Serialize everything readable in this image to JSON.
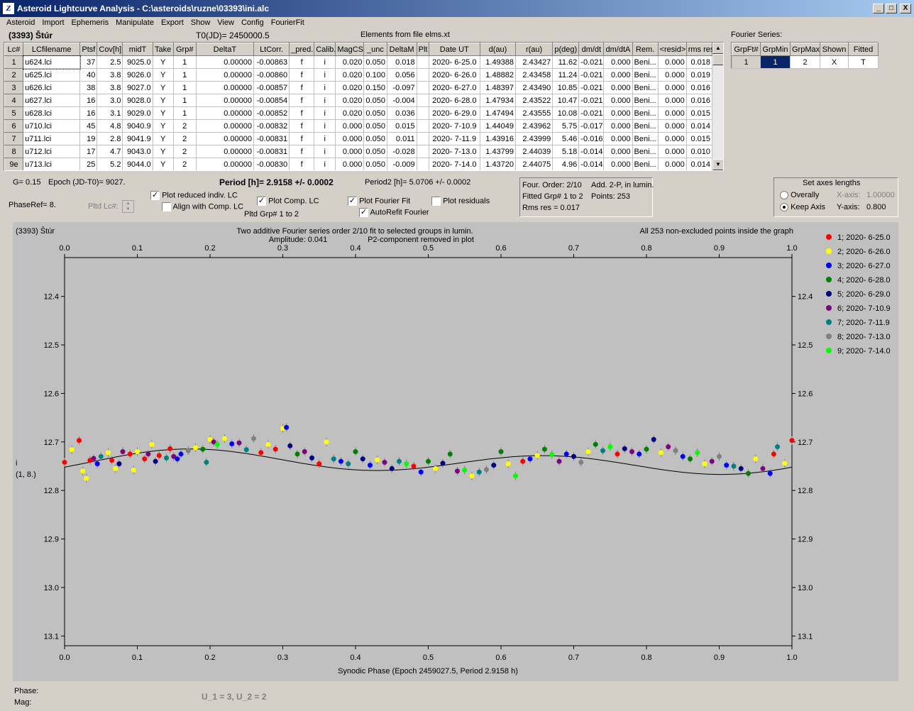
{
  "window": {
    "title": "Asteroid Lightcurve Analysis - C:\\asteroids\\ruzne\\03393\\ini.alc",
    "icon": "app-icon",
    "minimize": "_",
    "maximize": "□",
    "close": "X"
  },
  "menu": [
    "Asteroid",
    "Import",
    "Ephemeris",
    "Manipulate",
    "Export",
    "Show",
    "View",
    "Config",
    "FourierFit"
  ],
  "header": {
    "asteroid": "(3393) Štúr",
    "t0": "T0(JD)= 2450000.5",
    "elements": "Elements from file elms.xt",
    "fourier_series_label": "Fourier Series:"
  },
  "table": {
    "columns": [
      "Lc#",
      "LCfilename",
      "Ptsf",
      "Cov[h]",
      "midT",
      "Take",
      "Grp#",
      "DeltaT",
      "LtCorr.",
      "_pred.",
      "Calib.",
      "MagCS",
      "_unc",
      "DeltaM",
      "Plt",
      "Date UT",
      "d(au)",
      "r(au)",
      "p(deg)",
      "dm/dt",
      "dm/dtA",
      "Rem.",
      "<resid>",
      "rms res"
    ],
    "rows": [
      [
        "1",
        "u624.lci",
        "37",
        "2.5",
        "9025.0",
        "Y",
        "1",
        "0.00000",
        "-0.00863",
        "f",
        "i",
        "0.020",
        "0.050",
        "0.018",
        "",
        "2020- 6-25.0",
        "1.49388",
        "2.43427",
        "11.62",
        "-0.021",
        "0.000",
        "Beni...",
        "0.000",
        "0.018"
      ],
      [
        "2",
        "u625.lci",
        "40",
        "3.8",
        "9026.0",
        "Y",
        "1",
        "0.00000",
        "-0.00860",
        "f",
        "i",
        "0.020",
        "0.100",
        "0.056",
        "",
        "2020- 6-26.0",
        "1.48882",
        "2.43458",
        "11.24",
        "-0.021",
        "0.000",
        "Beni...",
        "0.000",
        "0.019"
      ],
      [
        "3",
        "u626.lci",
        "38",
        "3.8",
        "9027.0",
        "Y",
        "1",
        "0.00000",
        "-0.00857",
        "f",
        "i",
        "0.020",
        "0.150",
        "-0.097",
        "",
        "2020- 6-27.0",
        "1.48397",
        "2.43490",
        "10.85",
        "-0.021",
        "0.000",
        "Beni...",
        "0.000",
        "0.016"
      ],
      [
        "4",
        "u627.lci",
        "16",
        "3.0",
        "9028.0",
        "Y",
        "1",
        "0.00000",
        "-0.00854",
        "f",
        "i",
        "0.020",
        "0.050",
        "-0.004",
        "",
        "2020- 6-28.0",
        "1.47934",
        "2.43522",
        "10.47",
        "-0.021",
        "0.000",
        "Beni...",
        "0.000",
        "0.016"
      ],
      [
        "5",
        "u628.lci",
        "16",
        "3.1",
        "9029.0",
        "Y",
        "1",
        "0.00000",
        "-0.00852",
        "f",
        "i",
        "0.020",
        "0.050",
        "0.036",
        "",
        "2020- 6-29.0",
        "1.47494",
        "2.43555",
        "10.08",
        "-0.021",
        "0.000",
        "Beni...",
        "0.000",
        "0.015"
      ],
      [
        "6",
        "u710.lci",
        "45",
        "4.8",
        "9040.9",
        "Y",
        "2",
        "0.00000",
        "-0.00832",
        "f",
        "i",
        "0.000",
        "0.050",
        "0.015",
        "",
        "2020- 7-10.9",
        "1.44049",
        "2.43962",
        "5.75",
        "-0.017",
        "0.000",
        "Beni...",
        "0.000",
        "0.014"
      ],
      [
        "7",
        "u711.lci",
        "19",
        "2.8",
        "9041.9",
        "Y",
        "2",
        "0.00000",
        "-0.00831",
        "f",
        "i",
        "0.000",
        "0.050",
        "0.011",
        "",
        "2020- 7-11.9",
        "1.43916",
        "2.43999",
        "5.46",
        "-0.016",
        "0.000",
        "Beni...",
        "0.000",
        "0.015"
      ],
      [
        "8",
        "u712.lci",
        "17",
        "4.7",
        "9043.0",
        "Y",
        "2",
        "0.00000",
        "-0.00831",
        "f",
        "i",
        "0.000",
        "0.050",
        "-0.028",
        "",
        "2020- 7-13.0",
        "1.43799",
        "2.44039",
        "5.18",
        "-0.014",
        "0.000",
        "Beni...",
        "0.000",
        "0.010"
      ],
      [
        "9e",
        "u713.lci",
        "25",
        "5.2",
        "9044.0",
        "Y",
        "2",
        "0.00000",
        "-0.00830",
        "f",
        "i",
        "0.000",
        "0.050",
        "-0.009",
        "",
        "2020- 7-14.0",
        "1.43720",
        "2.44075",
        "4.96",
        "-0.014",
        "0.000",
        "Beni...",
        "0.000",
        "0.014"
      ]
    ]
  },
  "fourier_table": {
    "columns": [
      "GrpFt#",
      "GrpMin",
      "GrpMax",
      "Shown",
      "Fitted"
    ],
    "row": [
      "1",
      "1",
      "2",
      "X",
      "T"
    ]
  },
  "controls": {
    "g": "G= 0.15",
    "epoch": "Epoch (JD-T0)= 9027.",
    "period": "Period [h]= 2.9158 +/- 0.0002",
    "period2": "Period2 [h]= 5.0706 +/- 0.0002",
    "phaseref": "PhaseRef= 8.",
    "pltd_lc": "Pltd Lc#:",
    "plot_reduced": "Plot reduced indiv. LC",
    "align_comp": "Align with Comp. LC",
    "plot_comp": "Plot Comp. LC",
    "pltd_grp": "Pltd Grp#  1   to   2",
    "plot_fourier": "Plot Fourier Fit",
    "autorefit": "AutoRefit Fourier",
    "plot_residuals": "Plot residuals",
    "info_order": "Four. Order:  2/10",
    "info_add": "Add. 2-P, in lumin.",
    "info_fitted": "Fitted Grp# 1 to 2",
    "info_points": "Points: 253",
    "info_rms": "Rms res      = 0.017",
    "axes_title": "Set axes lengths",
    "overally": "Overally",
    "keep_axis": "Keep Axis",
    "x_axis_label": "X-axis:",
    "x_axis_value": "1.00000",
    "y_axis_label": "Y-axis:",
    "y_axis_value": "0.800",
    "phase": "Phase:",
    "mag": "Mag:",
    "u_values": "U_1 = 3, U_2 = 2"
  },
  "chart_data": {
    "type": "scatter",
    "title_left": "(3393) Štúr",
    "title_center_1": "Two additive Fourier series order 2/10 fit to selected groups in lumin.",
    "title_center_2": "Amplitude: 0.041",
    "title_center_3": "P2-component removed in plot",
    "title_right": "All 253 non-excluded points inside the graph",
    "xlabel": "Synodic Phase (Epoch 2459027.5, Period 2.9158 h)",
    "ylabel_1": "i",
    "ylabel_2": "(1, 8.)",
    "xlim": [
      0,
      1
    ],
    "ylim": [
      12.32,
      13.12
    ],
    "y_inverted": true,
    "xticks": [
      0.0,
      0.1,
      0.2,
      0.3,
      0.4,
      0.5,
      0.6,
      0.7,
      0.8,
      0.9,
      1.0
    ],
    "yticks": [
      12.4,
      12.5,
      12.6,
      12.7,
      12.8,
      12.9,
      13.0,
      13.1
    ],
    "series": [
      {
        "name": "1; 2020- 6-25.0",
        "color": "#ff0000"
      },
      {
        "name": "2; 2020- 6-26.0",
        "color": "#ffff00"
      },
      {
        "name": "3; 2020- 6-27.0",
        "color": "#0000ff"
      },
      {
        "name": "4; 2020- 6-28.0",
        "color": "#008000"
      },
      {
        "name": "5; 2020- 6-29.0",
        "color": "#000080"
      },
      {
        "name": "6; 2020- 7-10.9",
        "color": "#800080"
      },
      {
        "name": "7; 2020- 7-11.9",
        "color": "#008080"
      },
      {
        "name": "8; 2020- 7-13.0",
        "color": "#808080"
      },
      {
        "name": "9; 2020- 7-14.0",
        "color": "#00ff00"
      }
    ],
    "fit_curve": {
      "mean": 12.742,
      "amplitude": 0.041,
      "harmonics": [
        [
          0.0,
          -0.008
        ],
        [
          0.01,
          -0.018
        ]
      ]
    },
    "points": [
      [
        0.0,
        12.742,
        0
      ],
      [
        0.01,
        12.716,
        1
      ],
      [
        0.02,
        12.697,
        0
      ],
      [
        0.025,
        12.76,
        1
      ],
      [
        0.03,
        12.775,
        1
      ],
      [
        0.035,
        12.738,
        0
      ],
      [
        0.04,
        12.734,
        5
      ],
      [
        0.045,
        12.745,
        2
      ],
      [
        0.05,
        12.73,
        6
      ],
      [
        0.06,
        12.722,
        1
      ],
      [
        0.065,
        12.738,
        0
      ],
      [
        0.07,
        12.755,
        1
      ],
      [
        0.075,
        12.745,
        4
      ],
      [
        0.08,
        12.72,
        5
      ],
      [
        0.09,
        12.725,
        0
      ],
      [
        0.095,
        12.758,
        1
      ],
      [
        0.1,
        12.72,
        1
      ],
      [
        0.11,
        12.735,
        0
      ],
      [
        0.115,
        12.725,
        5
      ],
      [
        0.12,
        12.705,
        1
      ],
      [
        0.125,
        12.74,
        4
      ],
      [
        0.13,
        12.728,
        0
      ],
      [
        0.14,
        12.733,
        6
      ],
      [
        0.145,
        12.714,
        0
      ],
      [
        0.15,
        12.73,
        5
      ],
      [
        0.155,
        12.735,
        2
      ],
      [
        0.16,
        12.725,
        2
      ],
      [
        0.17,
        12.718,
        7
      ],
      [
        0.18,
        12.712,
        1
      ],
      [
        0.19,
        12.715,
        3
      ],
      [
        0.195,
        12.742,
        6
      ],
      [
        0.2,
        12.695,
        1
      ],
      [
        0.205,
        12.7,
        5
      ],
      [
        0.21,
        12.705,
        8
      ],
      [
        0.22,
        12.693,
        1
      ],
      [
        0.23,
        12.704,
        2
      ],
      [
        0.24,
        12.702,
        5
      ],
      [
        0.25,
        12.716,
        6
      ],
      [
        0.26,
        12.693,
        7
      ],
      [
        0.27,
        12.722,
        0
      ],
      [
        0.28,
        12.705,
        1
      ],
      [
        0.29,
        12.715,
        0
      ],
      [
        0.3,
        12.672,
        1
      ],
      [
        0.305,
        12.67,
        2
      ],
      [
        0.31,
        12.708,
        4
      ],
      [
        0.32,
        12.725,
        3
      ],
      [
        0.33,
        12.72,
        5
      ],
      [
        0.34,
        12.733,
        4
      ],
      [
        0.35,
        12.745,
        0
      ],
      [
        0.36,
        12.7,
        1
      ],
      [
        0.37,
        12.735,
        6
      ],
      [
        0.38,
        12.74,
        2
      ],
      [
        0.39,
        12.745,
        6
      ],
      [
        0.4,
        12.72,
        3
      ],
      [
        0.41,
        12.735,
        4
      ],
      [
        0.42,
        12.748,
        2
      ],
      [
        0.43,
        12.737,
        1
      ],
      [
        0.44,
        12.742,
        5
      ],
      [
        0.45,
        12.755,
        4
      ],
      [
        0.46,
        12.74,
        6
      ],
      [
        0.47,
        12.745,
        8
      ],
      [
        0.48,
        12.75,
        0
      ],
      [
        0.49,
        12.762,
        2
      ],
      [
        0.5,
        12.74,
        3
      ],
      [
        0.51,
        12.755,
        1
      ],
      [
        0.52,
        12.744,
        4
      ],
      [
        0.53,
        12.725,
        3
      ],
      [
        0.54,
        12.76,
        5
      ],
      [
        0.55,
        12.758,
        8
      ],
      [
        0.56,
        12.77,
        1
      ],
      [
        0.57,
        12.762,
        6
      ],
      [
        0.58,
        12.757,
        7
      ],
      [
        0.59,
        12.748,
        4
      ],
      [
        0.6,
        12.72,
        3
      ],
      [
        0.61,
        12.745,
        1
      ],
      [
        0.62,
        12.77,
        8
      ],
      [
        0.63,
        12.74,
        0
      ],
      [
        0.64,
        12.735,
        2
      ],
      [
        0.65,
        12.728,
        1
      ],
      [
        0.66,
        12.715,
        3
      ],
      [
        0.67,
        12.726,
        8
      ],
      [
        0.68,
        12.74,
        5
      ],
      [
        0.69,
        12.725,
        2
      ],
      [
        0.7,
        12.73,
        4
      ],
      [
        0.71,
        12.742,
        7
      ],
      [
        0.72,
        12.72,
        1
      ],
      [
        0.73,
        12.705,
        3
      ],
      [
        0.74,
        12.718,
        6
      ],
      [
        0.75,
        12.71,
        8
      ],
      [
        0.76,
        12.725,
        0
      ],
      [
        0.77,
        12.714,
        4
      ],
      [
        0.78,
        12.72,
        5
      ],
      [
        0.79,
        12.725,
        2
      ],
      [
        0.8,
        12.715,
        3
      ],
      [
        0.81,
        12.695,
        4
      ],
      [
        0.82,
        12.722,
        1
      ],
      [
        0.83,
        12.71,
        5
      ],
      [
        0.84,
        12.718,
        7
      ],
      [
        0.85,
        12.73,
        2
      ],
      [
        0.86,
        12.735,
        3
      ],
      [
        0.87,
        12.722,
        8
      ],
      [
        0.88,
        12.745,
        1
      ],
      [
        0.89,
        12.74,
        5
      ],
      [
        0.9,
        12.73,
        7
      ],
      [
        0.91,
        12.748,
        2
      ],
      [
        0.92,
        12.75,
        6
      ],
      [
        0.93,
        12.755,
        4
      ],
      [
        0.94,
        12.765,
        3
      ],
      [
        0.95,
        12.735,
        1
      ],
      [
        0.96,
        12.755,
        5
      ],
      [
        0.97,
        12.765,
        2
      ],
      [
        0.975,
        12.725,
        0
      ],
      [
        0.98,
        12.71,
        6
      ],
      [
        0.99,
        12.744,
        1
      ],
      [
        1.0,
        12.697,
        0
      ]
    ]
  }
}
